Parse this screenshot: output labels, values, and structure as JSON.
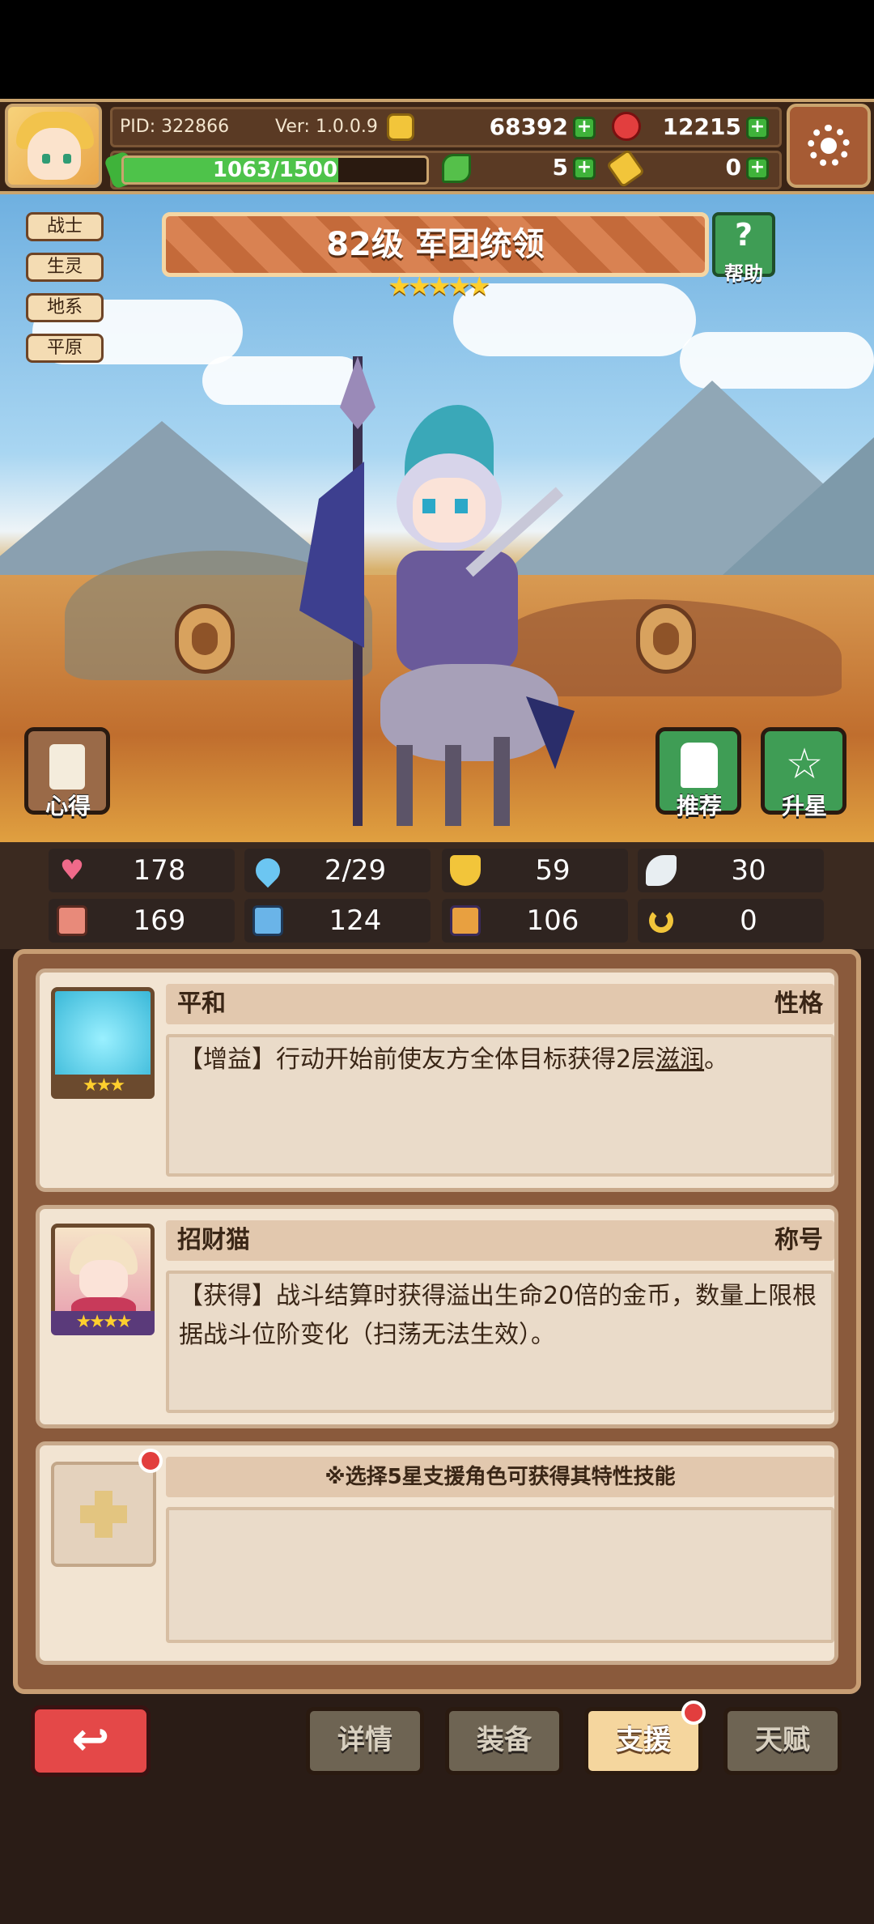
{
  "header": {
    "pid": "PID: 322866",
    "version": "Ver: 1.0.0.9",
    "gold": "68392",
    "gems": "12215",
    "exp": "1063/1500",
    "exp_fraction": 0.709,
    "clover": "5",
    "keys": "0"
  },
  "character": {
    "tags": [
      "战士",
      "生灵",
      "地系",
      "平原"
    ],
    "level_title": "82级 军团统领",
    "stars": "★★★★★",
    "help_label": "帮助",
    "heart_label": "心得",
    "recommend_label": "推荐",
    "starup_label": "升星"
  },
  "stats": [
    {
      "icon": "heart-icon",
      "value": "178"
    },
    {
      "icon": "drop-icon",
      "value": "2/29"
    },
    {
      "icon": "shield-icon",
      "value": "59"
    },
    {
      "icon": "wing-icon",
      "value": "30"
    },
    {
      "icon": "fist-icon",
      "value": "169"
    },
    {
      "icon": "book-icon",
      "value": "124"
    },
    {
      "icon": "flag-icon",
      "value": "106"
    },
    {
      "icon": "horseshoe-icon",
      "value": "0"
    }
  ],
  "cards": {
    "personality": {
      "name": "平和",
      "type": "性格",
      "stars": "★★★",
      "text_prefix": "【增益】行动开始前使友方全体目标获得2层",
      "text_link": "滋润",
      "text_suffix": "。"
    },
    "title": {
      "name": "招财猫",
      "type": "称号",
      "stars": "★★★★",
      "text": "【获得】战斗结算时获得溢出生命20倍的金币，数量上限根据战斗位阶变化（扫荡无法生效）。"
    },
    "support": {
      "hint": "※选择5星支援角色可获得其特性技能"
    }
  },
  "tabs": [
    "详情",
    "装备",
    "支援",
    "天赋"
  ],
  "colors": {
    "accent_green": "#3fb33a",
    "frame_gold": "#caa46e",
    "alert_red": "#e23e3e"
  }
}
